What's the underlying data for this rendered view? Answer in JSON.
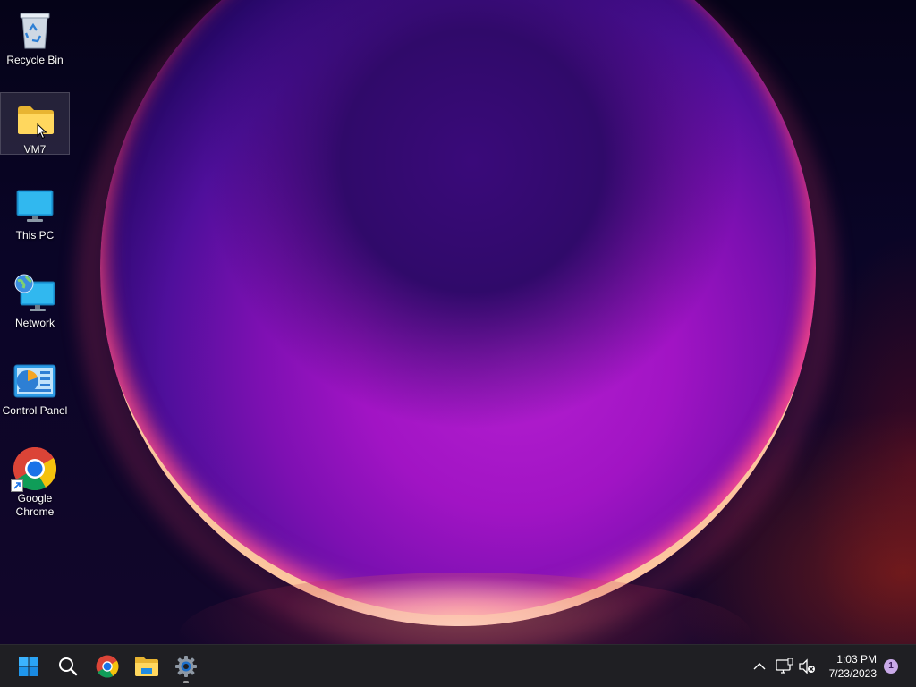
{
  "desktop": {
    "icons": [
      {
        "label": "Recycle Bin",
        "icon": "recycle-bin-icon"
      },
      {
        "label": "VM7",
        "icon": "folder-icon",
        "selected": true
      },
      {
        "label": "This PC",
        "icon": "monitor-icon"
      },
      {
        "label": "Network",
        "icon": "network-icon"
      },
      {
        "label": "Control Panel",
        "icon": "control-panel-icon"
      },
      {
        "label": "Google Chrome",
        "icon": "chrome-icon",
        "shortcut": true
      }
    ]
  },
  "taskbar": {
    "pinned": [
      {
        "name": "start",
        "icon": "windows-logo-icon"
      },
      {
        "name": "search",
        "icon": "search-icon"
      },
      {
        "name": "chrome",
        "icon": "chrome-icon"
      },
      {
        "name": "file-explorer",
        "icon": "folder-icon"
      },
      {
        "name": "settings",
        "icon": "gear-icon",
        "running": true
      }
    ],
    "tray": {
      "time": "1:03 PM",
      "date": "7/23/2023",
      "notification_count": "1"
    }
  },
  "colors": {
    "accent": "#0078d4",
    "taskbar_bg": "#1f1f23",
    "badge": "#c9a9e8"
  }
}
